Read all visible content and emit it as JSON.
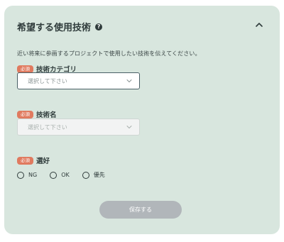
{
  "section": {
    "title": "希望する使用技術",
    "description": "近い将来に参画するプロジェクトで使用したい技術を伝えてください。"
  },
  "fields": {
    "category": {
      "required_label": "必須",
      "label": "技術カテゴリ",
      "placeholder": "選択して下さい"
    },
    "tech_name": {
      "required_label": "必須",
      "label": "技術名",
      "placeholder": "選択して下さい"
    },
    "preference": {
      "required_label": "必須",
      "label": "選好",
      "options": [
        "NG",
        "OK",
        "優先"
      ]
    }
  },
  "actions": {
    "save_label": "保存する"
  }
}
